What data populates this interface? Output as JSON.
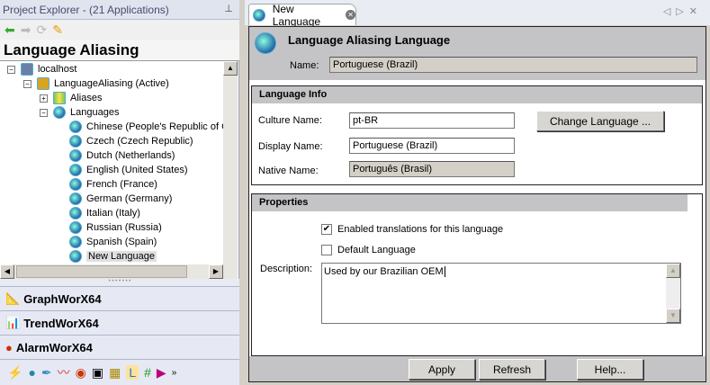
{
  "explorer": {
    "title": "Project Explorer - (21 Applications)",
    "heading": "Language Aliasing",
    "tree": [
      {
        "label": "localhost",
        "level": 0,
        "exp": "−",
        "icon": "server-icon"
      },
      {
        "label": "LanguageAliasing (Active)",
        "level": 1,
        "exp": "−",
        "icon": "project-icon"
      },
      {
        "label": "Aliases",
        "level": 2,
        "exp": "+",
        "icon": "aliases-icon"
      },
      {
        "label": "Languages",
        "level": 2,
        "exp": "−",
        "icon": "globe-icon"
      },
      {
        "label": "Chinese (People's Republic of C",
        "level": 3
      },
      {
        "label": "Czech (Czech Republic)",
        "level": 3
      },
      {
        "label": "Dutch (Netherlands)",
        "level": 3
      },
      {
        "label": "English (United States)",
        "level": 3
      },
      {
        "label": "French (France)",
        "level": 3
      },
      {
        "label": "German (Germany)",
        "level": 3
      },
      {
        "label": "Italian (Italy)",
        "level": 3
      },
      {
        "label": "Russian (Russia)",
        "level": 3
      },
      {
        "label": "Spanish (Spain)",
        "level": 3
      },
      {
        "label": "New Language",
        "level": 3,
        "selected": true
      }
    ],
    "modules": [
      "GraphWorX64",
      "TrendWorX64",
      "AlarmWorX64"
    ]
  },
  "tab": {
    "label": "New Language"
  },
  "form": {
    "title": "Language Aliasing Language",
    "name_label": "Name:",
    "name_value": "Portuguese (Brazil)",
    "info_title": "Language Info",
    "culture_label": "Culture Name:",
    "culture_value": "pt-BR",
    "display_label": "Display Name:",
    "display_value": "Portuguese (Brazil)",
    "native_label": "Native Name:",
    "native_value": "Português (Brasil)",
    "change_btn": "Change Language ...",
    "props_title": "Properties",
    "enabled_label": "Enabled translations for this language",
    "enabled_checked": true,
    "default_label": "Default Language",
    "default_checked": false,
    "desc_label": "Description:",
    "desc_value": "Used by our Brazilian OEM",
    "apply": "Apply",
    "refresh": "Refresh",
    "help": "Help..."
  }
}
